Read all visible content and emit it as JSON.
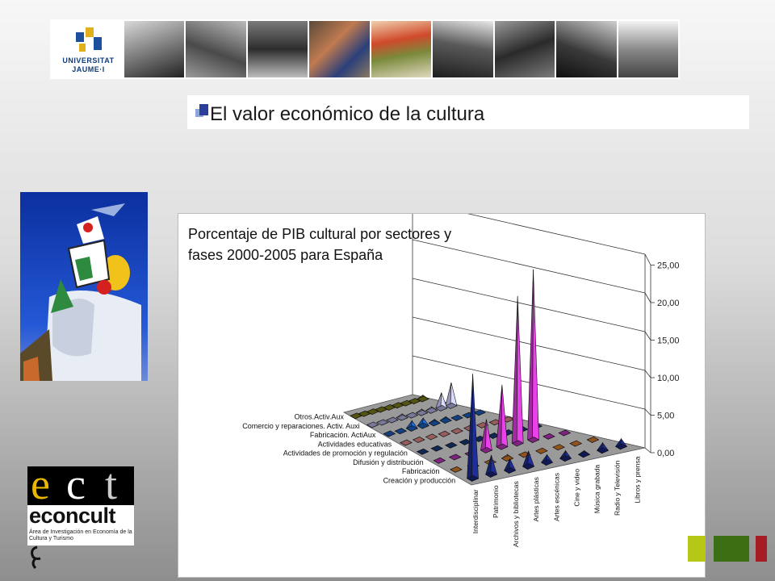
{
  "header": {
    "logo_line1": "UNIVERSITAT",
    "logo_line2": "JAUME·I"
  },
  "slide": {
    "title": "El valor económico de la cultura"
  },
  "chart_title_text": "Porcentaje de PIB cultural por sectores y fases 2000-2005 para España",
  "ect_logo": {
    "letters": [
      "e",
      "c",
      "t"
    ],
    "name": "econcult",
    "subtitle": "Área de Investigación en Economía de la Cultura y Turismo"
  },
  "colors": {
    "accent_blue": "#1f3f99",
    "green_square": "#3c6e14",
    "red_square": "#a51c24",
    "lime_square": "#b5c818"
  },
  "chart_data": {
    "type": "bar",
    "variant": "3d-pyramid",
    "title": "Porcentaje de PIB cultural por sectores y fases 2000-2005 para España",
    "zlim": [
      0,
      25
    ],
    "z_ticks": [
      "0,00",
      "5,00",
      "10,00",
      "15,00",
      "20,00",
      "25,00"
    ],
    "categories": [
      "Interdisciplinar",
      "Patrimonio",
      "Archivos y bibliotecas",
      "Artes plásticas",
      "Artes escénicas",
      "Cine y video",
      "Música grabada",
      "Radio y Televisión",
      "Libros y prensa"
    ],
    "series": [
      {
        "name": "Creación   y   producción",
        "color": "#1b2a8c",
        "values": [
          13.5,
          2.5,
          1.5,
          2,
          1,
          1,
          0.5,
          1,
          1
        ]
      },
      {
        "name": "Fabricación",
        "color": "#f08a2e",
        "values": [
          0.2,
          0.2,
          0.2,
          0.5,
          0.2,
          0.2,
          0.2,
          0.2,
          0.2
        ]
      },
      {
        "name": "Difusión y distribución",
        "color": "#d63bd6",
        "values": [
          0.2,
          0.2,
          0.2,
          4,
          8,
          19,
          22,
          0.2,
          0.2
        ]
      },
      {
        "name": "Actividades de promoción y regulación",
        "color": "#1a3f8a",
        "values": [
          0.2,
          0.2,
          0.2,
          0.2,
          0.2,
          0.2,
          0.2,
          0.2,
          0.2
        ]
      },
      {
        "name": "Actividades educativas",
        "color": "#ff9a9a",
        "values": [
          0.2,
          0.2,
          0.2,
          0.2,
          0.2,
          0.2,
          0.2,
          0.2,
          0.2
        ]
      },
      {
        "name": "Fabricación. ActiAux",
        "color": "#1f6ad6",
        "values": [
          0.2,
          0.2,
          1,
          1,
          0.5,
          0.5,
          0.2,
          0.2,
          0.2
        ]
      },
      {
        "name": "Comercio y reparaciones. Activ. Auxi",
        "color": "#c8c8ff",
        "values": [
          0.2,
          0.2,
          0.2,
          0.5,
          0.2,
          0.5,
          0.5,
          2,
          3
        ]
      },
      {
        "name": "Otros.Activ.Aux",
        "color": "#8b8b1e",
        "values": [
          0.2,
          0.2,
          0.2,
          0.2,
          0.2,
          0.2,
          0.2,
          0.2,
          0.5
        ]
      }
    ]
  }
}
